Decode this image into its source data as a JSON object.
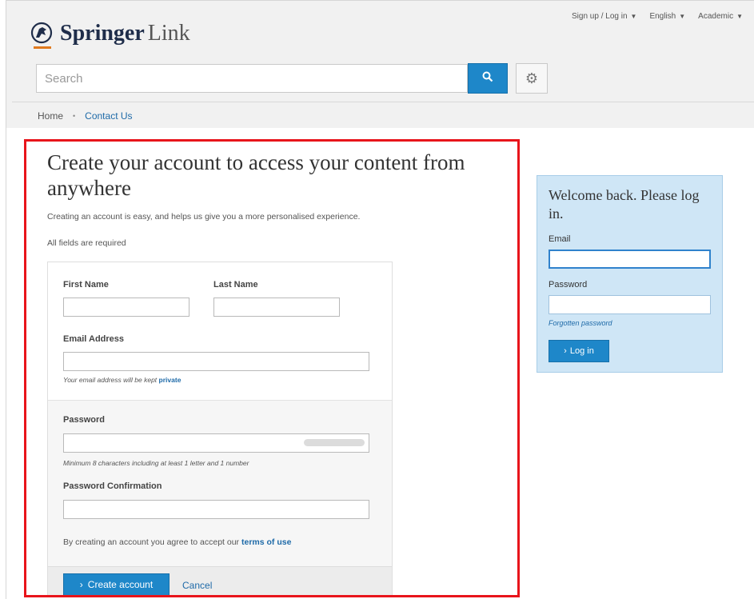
{
  "header": {
    "top_links": [
      {
        "label": "Sign up / Log in",
        "caret": "▼"
      },
      {
        "label": "English",
        "caret": "▼"
      },
      {
        "label": "Academic",
        "caret": "▼"
      }
    ],
    "logo": {
      "brand": "Springer",
      "suffix": "Link",
      "icon": "springer-horse-icon",
      "underline_color": "#e07a1f"
    },
    "search": {
      "placeholder": "Search",
      "search_icon": "search-icon",
      "settings_icon": "gear-icon"
    }
  },
  "breadcrumb": {
    "home": "Home",
    "separator": "•",
    "current": "Contact Us"
  },
  "register": {
    "highlight_color": "#e8141b",
    "title": "Create your account to access your content from anywhere",
    "intro": "Creating an account is easy, and helps us give you a more personalised experience.",
    "required_note": "All fields are required",
    "first_name_label": "First Name",
    "last_name_label": "Last Name",
    "email_label": "Email Address",
    "email_note_prefix": "Your email address will be kept",
    "email_note_link": "private",
    "password_label": "Password",
    "password_note": "Minimum 8 characters including at least 1 letter and 1 number",
    "confirm_label": "Password Confirmation",
    "agree_prefix": "By creating an account you agree to accept our",
    "agree_link": "terms of use",
    "create_button": "Create account",
    "cancel_link": "Cancel"
  },
  "login": {
    "title": "Welcome back. Please log in.",
    "email_label": "Email",
    "password_label": "Password",
    "forgot_link": "Forgotten password",
    "login_button": "Log in"
  },
  "colors": {
    "accent": "#1e87c9",
    "link": "#1e6aa8",
    "login_panel": "#cfe6f6"
  }
}
